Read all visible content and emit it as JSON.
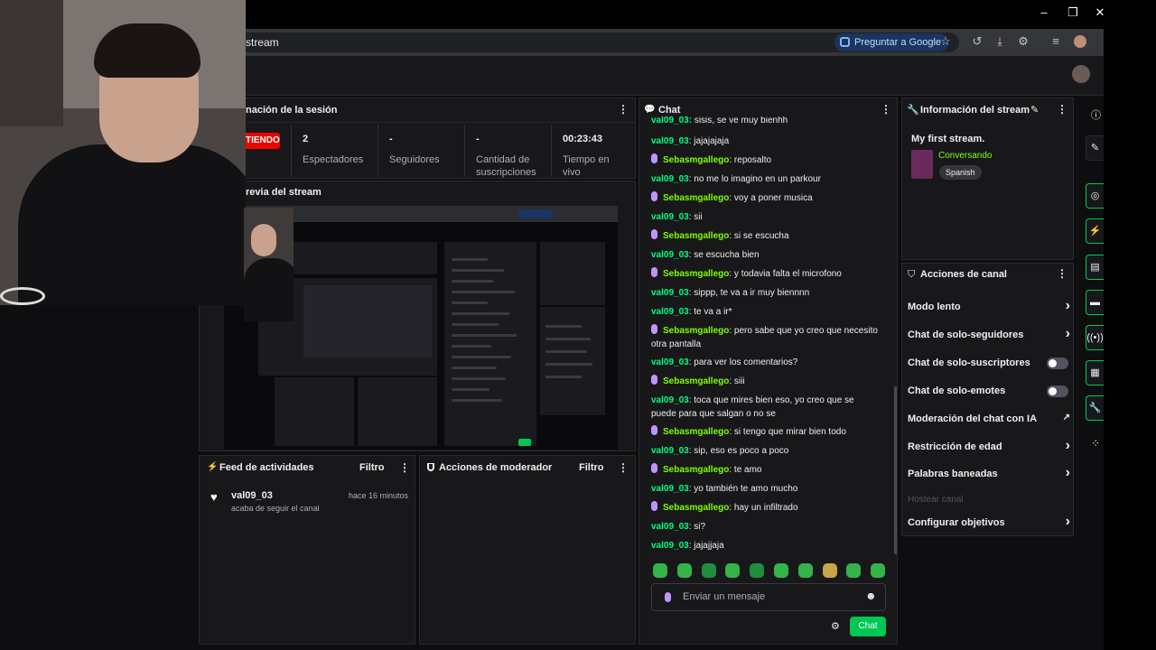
{
  "browser": {
    "url_text": "stream",
    "google_button": "Preguntar a Google",
    "window_controls": {
      "minimize": "–",
      "restore": "❐",
      "close": "✕"
    }
  },
  "session": {
    "title": "nación de la sesión",
    "live_label": "TIENDO",
    "stats": [
      {
        "value": "2",
        "label": "Espectadores"
      },
      {
        "value": "-",
        "label": "Seguidores"
      },
      {
        "value": "-",
        "label": "Cantidad de suscripciones"
      },
      {
        "value": "00:23:43",
        "label": "Tiempo en vivo"
      }
    ]
  },
  "preview": {
    "title": "revia del stream"
  },
  "activity": {
    "title": "Feed de actividades",
    "filter": "Filtro",
    "items": [
      {
        "user": "val09_03",
        "time": "hace 16 minutos",
        "text": "acaba de seguir el canal"
      }
    ]
  },
  "mod": {
    "title": "Acciones de moderador",
    "filter": "Filtro"
  },
  "chat": {
    "title": "Chat",
    "top_cut": "sisis, se ve muy bienhh",
    "messages": [
      {
        "user": "val09_03",
        "text": "jajajajaja",
        "mic": false
      },
      {
        "user": "Sebasmgallego",
        "text": "reposalto",
        "mic": true
      },
      {
        "user": "val09_03",
        "text": "no me lo imagino en un parkour",
        "mic": false
      },
      {
        "user": "Sebasmgallego",
        "text": "voy a poner musica",
        "mic": true
      },
      {
        "user": "val09_03",
        "text": "sii",
        "mic": false
      },
      {
        "user": "Sebasmgallego",
        "text": "si se escucha",
        "mic": true
      },
      {
        "user": "val09_03",
        "text": "se escucha bien",
        "mic": false
      },
      {
        "user": "Sebasmgallego",
        "text": "y todavia falta el microfono",
        "mic": true
      },
      {
        "user": "val09_03",
        "text": "sippp, te va a ir muy biennnn",
        "mic": false
      },
      {
        "user": "val09_03",
        "text": "te va a ir*",
        "mic": false
      },
      {
        "user": "Sebasmgallego",
        "text": "pero sabe que yo creo que necesito otra pantalla",
        "mic": true
      },
      {
        "user": "val09_03",
        "text": "para ver los comentarios?",
        "mic": false
      },
      {
        "user": "Sebasmgallego",
        "text": "siii",
        "mic": true
      },
      {
        "user": "val09_03",
        "text": "toca que mires bien eso, yo creo que se puede para que salgan o no se",
        "mic": false
      },
      {
        "user": "Sebasmgallego",
        "text": "si tengo que mirar bien todo",
        "mic": true
      },
      {
        "user": "val09_03",
        "text": "sip, eso es poco a poco",
        "mic": false
      },
      {
        "user": "Sebasmgallego",
        "text": "te amo",
        "mic": true
      },
      {
        "user": "val09_03",
        "text": "yo también te amo mucho",
        "mic": false
      },
      {
        "user": "Sebasmgallego",
        "text": "hay un infiltrado",
        "mic": true
      },
      {
        "user": "val09_03",
        "text": "si?",
        "mic": false
      },
      {
        "user": "val09_03",
        "text": "jajajjaja",
        "mic": false
      }
    ],
    "input_placeholder": "Enviar un mensaje",
    "send_label": "Chat"
  },
  "stream_info": {
    "title": "Información del stream",
    "stream_title": "My first stream.",
    "category": "Conversando",
    "tag": "Spanish"
  },
  "channel_actions": {
    "title": "Acciones de canal",
    "items": [
      {
        "label": "Modo lento",
        "control": "chevron"
      },
      {
        "label": "Chat de solo-seguidores",
        "control": "chevron"
      },
      {
        "label": "Chat de solo-suscriptores",
        "control": "toggle"
      },
      {
        "label": "Chat de solo-emotes",
        "control": "toggle"
      },
      {
        "label": "Moderación del chat con IA",
        "control": "external"
      },
      {
        "label": "Restricción de edad",
        "control": "chevron"
      },
      {
        "label": "Palabras baneadas",
        "control": "chevron"
      },
      {
        "label": "Hostear canal",
        "control": "disabled"
      },
      {
        "label": "Configurar objetivos",
        "control": "chevron"
      }
    ]
  },
  "colors": {
    "brand": "#9146ff",
    "user_val": "#00ff7f",
    "user_seb": "#7fff00",
    "live": "#eb0400",
    "send_button": "#00c853"
  },
  "icons": {
    "side": [
      "info-icon",
      "pencil-icon",
      "camera-icon",
      "bolt-icon",
      "doc-icon",
      "chat-icon",
      "broadcast-icon",
      "layout-icon",
      "wrench-icon",
      "more-icon"
    ]
  }
}
